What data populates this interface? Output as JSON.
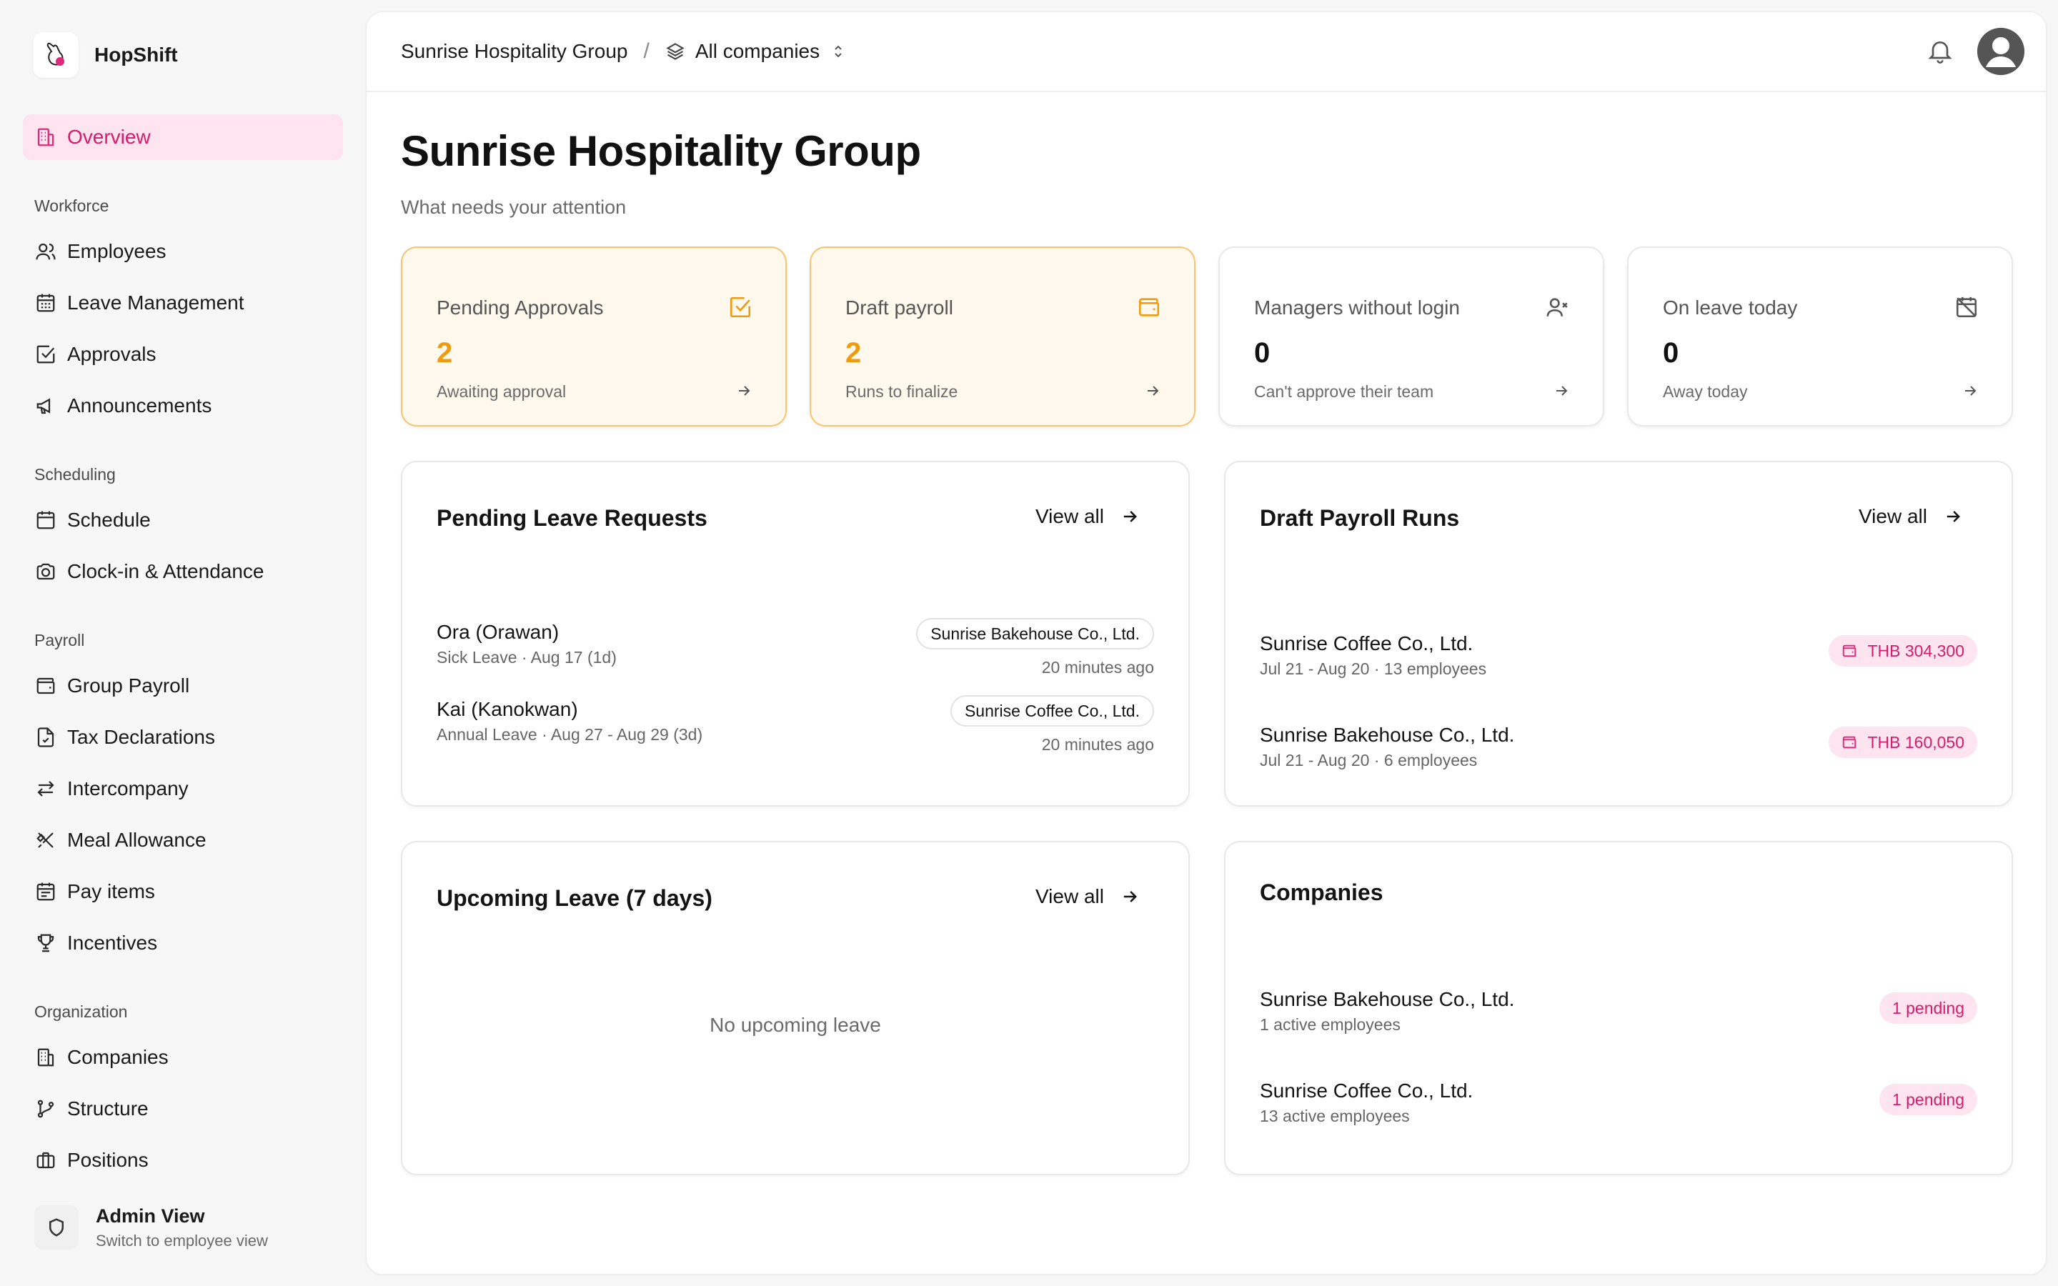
{
  "brand": {
    "name": "HopShift"
  },
  "nav": {
    "overview": "Overview",
    "workforce_label": "Workforce",
    "employees": "Employees",
    "leave_management": "Leave Management",
    "approvals": "Approvals",
    "announcements": "Announcements",
    "scheduling_label": "Scheduling",
    "schedule": "Schedule",
    "clock_in": "Clock-in & Attendance",
    "payroll_label": "Payroll",
    "group_payroll": "Group Payroll",
    "tax_declarations": "Tax Declarations",
    "intercompany": "Intercompany",
    "meal_allowance": "Meal Allowance",
    "pay_items": "Pay items",
    "incentives": "Incentives",
    "organization_label": "Organization",
    "companies": "Companies",
    "structure": "Structure",
    "positions": "Positions"
  },
  "admin": {
    "title": "Admin View",
    "subtitle": "Switch to employee view"
  },
  "topbar": {
    "group": "Sunrise Hospitality Group",
    "separator": "/",
    "company_selector": "All companies"
  },
  "page": {
    "title": "Sunrise Hospitality Group",
    "subtitle": "What needs your attention"
  },
  "stats": [
    {
      "title": "Pending Approvals",
      "value": "2",
      "subtitle": "Awaiting approval",
      "icon": "check-square-icon"
    },
    {
      "title": "Draft payroll",
      "value": "2",
      "subtitle": "Runs to finalize",
      "icon": "wallet-icon"
    },
    {
      "title": "Managers without login",
      "value": "0",
      "subtitle": "Can't approve their team",
      "icon": "user-x-icon"
    },
    {
      "title": "On leave today",
      "value": "0",
      "subtitle": "Away today",
      "icon": "calendar-off-icon"
    }
  ],
  "pending_leave": {
    "title": "Pending Leave Requests",
    "view_all": "View all",
    "rows": [
      {
        "name": "Ora (Orawan)",
        "detail": "Sick Leave · Aug 17 (1d)",
        "company": "Sunrise Bakehouse Co., Ltd.",
        "time": "20 minutes ago"
      },
      {
        "name": "Kai (Kanokwan)",
        "detail": "Annual Leave · Aug 27 - Aug 29 (3d)",
        "company": "Sunrise Coffee Co., Ltd.",
        "time": "20 minutes ago"
      }
    ]
  },
  "draft_payroll": {
    "title": "Draft Payroll Runs",
    "view_all": "View all",
    "rows": [
      {
        "name": "Sunrise Coffee Co., Ltd.",
        "detail": "Jul 21 - Aug 20 · 13 employees",
        "amount": "THB 304,300"
      },
      {
        "name": "Sunrise Bakehouse Co., Ltd.",
        "detail": "Jul 21 - Aug 20 · 6 employees",
        "amount": "THB 160,050"
      }
    ]
  },
  "upcoming_leave": {
    "title": "Upcoming Leave (7 days)",
    "view_all": "View all",
    "empty": "No upcoming leave"
  },
  "companies": {
    "title": "Companies",
    "rows": [
      {
        "name": "Sunrise Bakehouse Co., Ltd.",
        "detail": "1 active employees",
        "badge": "1 pending"
      },
      {
        "name": "Sunrise Coffee Co., Ltd.",
        "detail": "13 active employees",
        "badge": "1 pending"
      }
    ]
  },
  "colors": {
    "accent_pink": "#d81b6a",
    "warning_orange": "#f09a0e",
    "warning_bg": "#fff8ec"
  }
}
